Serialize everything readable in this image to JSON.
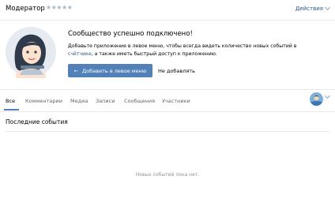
{
  "header": {
    "title": "Модератор",
    "rating": "★★★★★",
    "actions_label": "Действия"
  },
  "notice": {
    "title": "Сообщество успешно подключено!",
    "desc_part1": "Добавьте приложение в левое меню, чтобы всегда видеть количество новых событий в ",
    "desc_link": "счётчике",
    "desc_part2": ", а также иметь быстрый доступ к приложению.",
    "add_button": "Добавить в левое меню",
    "add_button_arrow": "←",
    "skip_button": "Не добавлять"
  },
  "tabs": {
    "all": "Все",
    "comments": "Комментарии",
    "media": "Медиа",
    "posts": "Записи",
    "messages": "Сообщения",
    "members": "Участники"
  },
  "events": {
    "heading": "Последние события",
    "empty_text": "Новых событий пока нет."
  },
  "colors": {
    "accent": "#5181b8",
    "link": "#2a5885",
    "border": "#e7e8ec",
    "muted": "#939393"
  },
  "icons": [
    "chevron-down-icon",
    "arrow-left-icon",
    "moderator-illustration",
    "group-avatar"
  ]
}
